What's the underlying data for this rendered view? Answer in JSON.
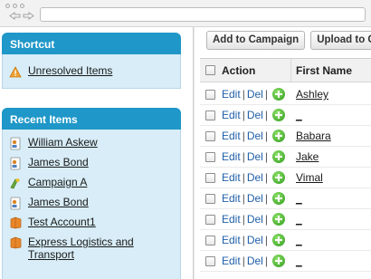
{
  "sidebar": {
    "shortcut": {
      "title": "Shortcut",
      "items": [
        {
          "label": "Unresolved Items",
          "icon": "warning-icon"
        }
      ]
    },
    "recent": {
      "title": "Recent Items",
      "items": [
        {
          "label": "William Askew",
          "icon": "contact-card-icon"
        },
        {
          "label": "James Bond",
          "icon": "contact-card-icon"
        },
        {
          "label": "Campaign A",
          "icon": "campaign-icon"
        },
        {
          "label": "James Bond",
          "icon": "contact-card-icon"
        },
        {
          "label": "Test Account1",
          "icon": "account-folder-icon"
        },
        {
          "label": "Express Logistics and Transport",
          "icon": "account-folder-icon"
        }
      ]
    }
  },
  "toolbar": {
    "add_to_campaign": "Add to Campaign",
    "upload_to": "Upload to Co"
  },
  "table": {
    "headers": {
      "action": "Action",
      "first_name": "First Name"
    },
    "action_edit": "Edit",
    "action_sep": "|",
    "action_del": "Del",
    "rows": [
      {
        "first_name": "Ashley"
      },
      {
        "first_name": "_"
      },
      {
        "first_name": "Babara"
      },
      {
        "first_name": "Jake"
      },
      {
        "first_name": "Vimal"
      },
      {
        "first_name": "_"
      },
      {
        "first_name": "_"
      },
      {
        "first_name": "_"
      },
      {
        "first_name": "_"
      }
    ]
  }
}
